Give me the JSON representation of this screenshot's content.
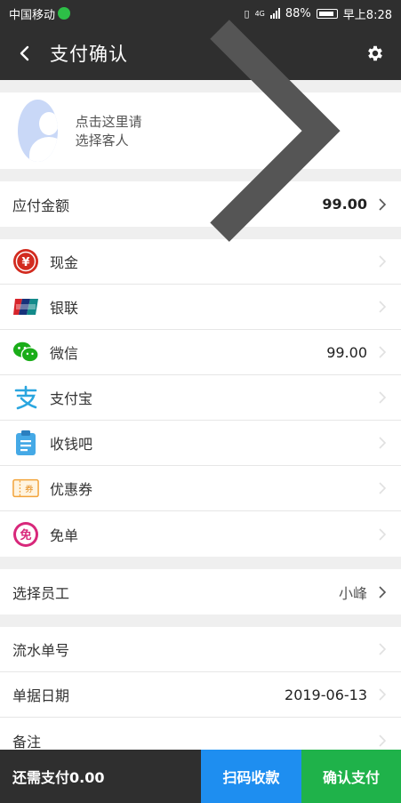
{
  "status": {
    "carrier": "中国移动",
    "battery": "88%",
    "time": "早上8:28",
    "net": "4G"
  },
  "nav": {
    "title": "支付确认"
  },
  "customer": {
    "prompt": "点击这里请选择客人"
  },
  "amount_due": {
    "label": "应付金额",
    "value": "99.00"
  },
  "payments": [
    {
      "label": "现金",
      "value": "",
      "icon": "cash-yuan-icon"
    },
    {
      "label": "银联",
      "value": "",
      "icon": "unionpay-icon"
    },
    {
      "label": "微信",
      "value": "99.00",
      "icon": "wechat-icon"
    },
    {
      "label": "支付宝",
      "value": "",
      "icon": "alipay-icon"
    },
    {
      "label": "收钱吧",
      "value": "",
      "icon": "clipboard-icon"
    },
    {
      "label": "优惠券",
      "value": "",
      "icon": "coupon-icon"
    },
    {
      "label": "免单",
      "value": "",
      "icon": "free-icon"
    }
  ],
  "staff": {
    "label": "选择员工",
    "value": "小峰"
  },
  "details": [
    {
      "label": "流水单号",
      "value": ""
    },
    {
      "label": "单据日期",
      "value": "2019-06-13"
    },
    {
      "label": "备注",
      "value": ""
    }
  ],
  "footer": {
    "remaining": "还需支付0.00",
    "scan": "扫码收款",
    "confirm": "确认支付"
  },
  "colors": {
    "header": "#2f2f2f",
    "amount": "#d9141b",
    "scan": "#1e8ef0",
    "confirm": "#1fb24a"
  }
}
